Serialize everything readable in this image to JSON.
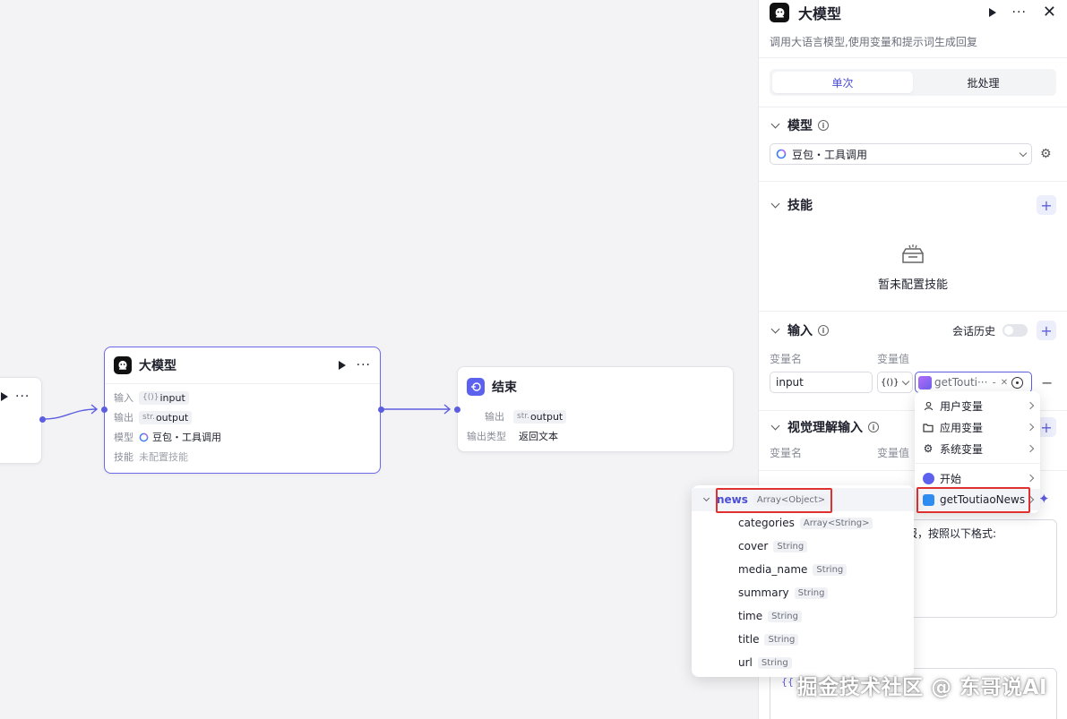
{
  "canvas": {
    "llm_node": {
      "title": "大模型",
      "rows": [
        {
          "key": "输入",
          "prefix": "{()}",
          "value": "input"
        },
        {
          "key": "输出",
          "prefix": "str.",
          "value": "output"
        },
        {
          "key": "模型",
          "value": "豆包・工具调用"
        },
        {
          "key": "技能",
          "value": "未配置技能"
        }
      ]
    },
    "end_node": {
      "title": "结束",
      "output_label": "输出",
      "output_prefix": "str.",
      "output_value": "output",
      "type_label": "输出类型",
      "type_value": "返回文本"
    },
    "left_node": {
      "more": "···"
    }
  },
  "panel": {
    "title": "大模型",
    "description": "调用大语言模型,使用变量和提示词生成回复",
    "tabs": [
      "单次",
      "批处理"
    ],
    "model_section": {
      "title": "模型",
      "selected": "豆包・工具调用"
    },
    "skill_section": {
      "title": "技能",
      "empty": "暂未配置技能"
    },
    "input_section": {
      "title": "输入",
      "history_label": "会话历史",
      "col_name": "变量名",
      "col_value": "变量值",
      "var_name": "input",
      "type_label": "{()}",
      "ref_value": "getTouti···",
      "ref_suffix": "-"
    },
    "vision_section": {
      "title": "视觉理解输入",
      "col_name": "变量名",
      "col_value": "变量值"
    },
    "prompt_partial": "日报，按照以下格式:",
    "prompt2_partial": "{{"
  },
  "var_menu": {
    "groups": [
      {
        "label": "用户变量",
        "icon": "user-icon"
      },
      {
        "label": "应用变量",
        "icon": "folder-icon"
      },
      {
        "label": "系统变量",
        "icon": "gear-icon"
      }
    ],
    "nodes": [
      {
        "label": "开始",
        "icon": "start-icon"
      },
      {
        "label": "getToutiaoNews",
        "icon": "plugin-icon"
      }
    ]
  },
  "field_menu": {
    "root": {
      "name": "news",
      "type": "Array<Object>"
    },
    "children": [
      {
        "name": "categories",
        "type": "Array<String>"
      },
      {
        "name": "cover",
        "type": "String"
      },
      {
        "name": "media_name",
        "type": "String"
      },
      {
        "name": "summary",
        "type": "String"
      },
      {
        "name": "time",
        "type": "String"
      },
      {
        "name": "title",
        "type": "String"
      },
      {
        "name": "url",
        "type": "String"
      }
    ]
  },
  "watermark": "掘金技术社区 @ 东哥说AI",
  "colors": {
    "accent": "#5c5ee0",
    "highlight": "#e03131",
    "border": "#d9dbe0"
  }
}
